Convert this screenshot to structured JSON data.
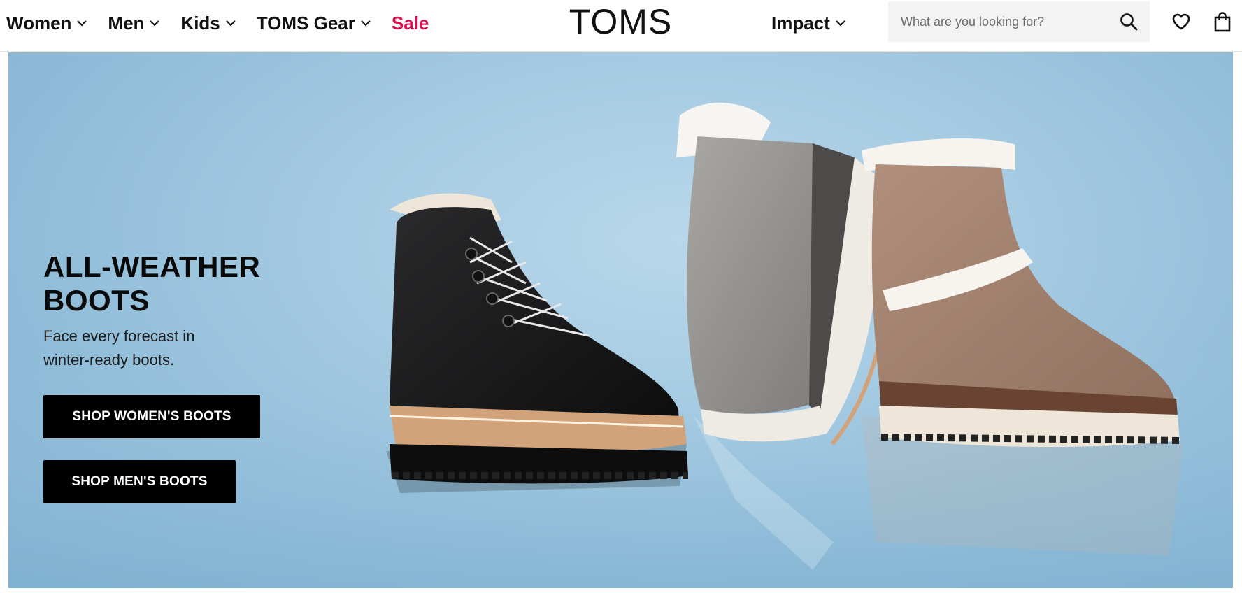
{
  "header": {
    "nav": [
      {
        "label": "Women",
        "has_dropdown": true
      },
      {
        "label": "Men",
        "has_dropdown": true
      },
      {
        "label": "Kids",
        "has_dropdown": true
      },
      {
        "label": "TOMS Gear",
        "has_dropdown": true
      },
      {
        "label": "Sale",
        "has_dropdown": false,
        "color": "#d6104f"
      }
    ],
    "logo": "TOMS",
    "impact": {
      "label": "Impact",
      "has_dropdown": true
    },
    "search": {
      "placeholder": "What are you looking for?",
      "icon": "search-icon"
    },
    "wishlist_icon": "heart-icon",
    "bag_icon": "shopping-bag-icon"
  },
  "hero": {
    "title": "ALL-WEATHER BOOTS",
    "subtitle": "Face every forecast in winter-ready boots.",
    "buttons": [
      {
        "label": "SHOP WOMEN'S BOOTS"
      },
      {
        "label": "SHOP MEN'S BOOTS"
      }
    ],
    "background_color": "#a6cbe2"
  }
}
